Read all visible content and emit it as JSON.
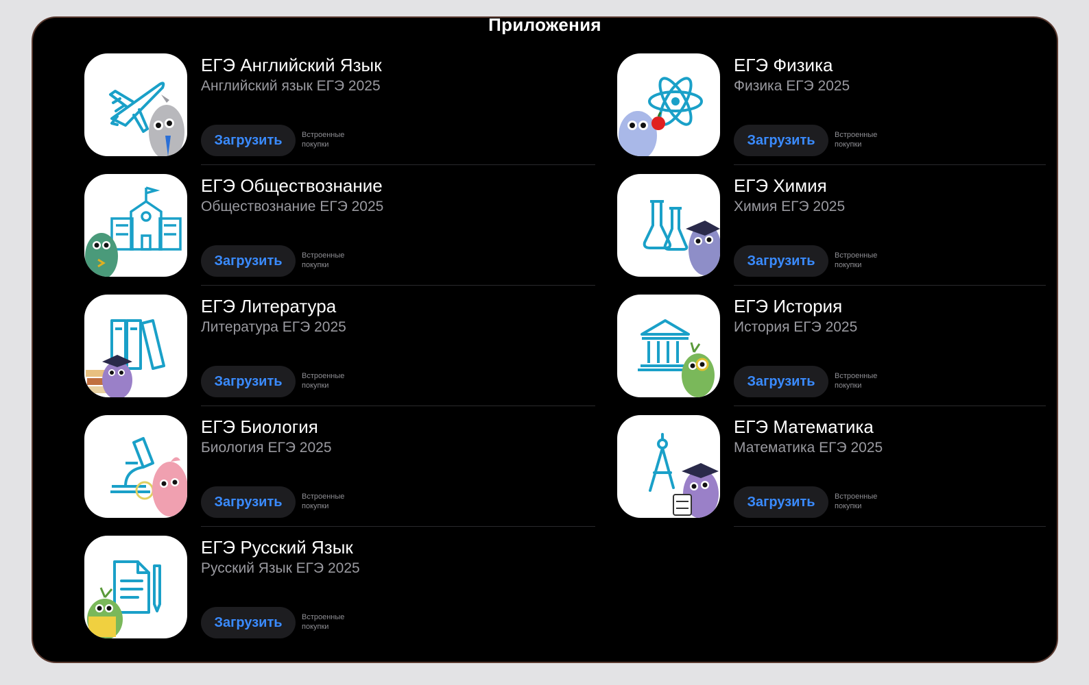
{
  "section_title": "Приложения",
  "get_label": "Загрузить",
  "iap_line1": "Встроенные",
  "iap_line2": "покупки",
  "colors": {
    "accent": "#3a8bff",
    "background": "#000000",
    "button_bg": "#1d1d20",
    "subtitle": "#9a9aa0"
  },
  "apps": [
    {
      "name": "ЕГЭ Английский Язык",
      "subtitle": "Английский язык ЕГЭ 2025",
      "icon": "airplane-icon"
    },
    {
      "name": "ЕГЭ Физика",
      "subtitle": "Физика ЕГЭ 2025",
      "icon": "atom-icon"
    },
    {
      "name": "ЕГЭ Обществознание",
      "subtitle": "Обществознание ЕГЭ 2025",
      "icon": "school-building-icon"
    },
    {
      "name": "ЕГЭ Химия",
      "subtitle": "Химия ЕГЭ 2025",
      "icon": "flasks-icon"
    },
    {
      "name": "ЕГЭ Литература",
      "subtitle": "Литература ЕГЭ 2025",
      "icon": "books-icon"
    },
    {
      "name": "ЕГЭ История",
      "subtitle": "История ЕГЭ 2025",
      "icon": "museum-icon"
    },
    {
      "name": "ЕГЭ Биология",
      "subtitle": "Биология ЕГЭ 2025",
      "icon": "microscope-icon"
    },
    {
      "name": "ЕГЭ Математика",
      "subtitle": "Математика ЕГЭ 2025",
      "icon": "compass-icon"
    },
    {
      "name": "ЕГЭ Русский Язык",
      "subtitle": "Русский Язык ЕГЭ 2025",
      "icon": "document-icon"
    }
  ]
}
